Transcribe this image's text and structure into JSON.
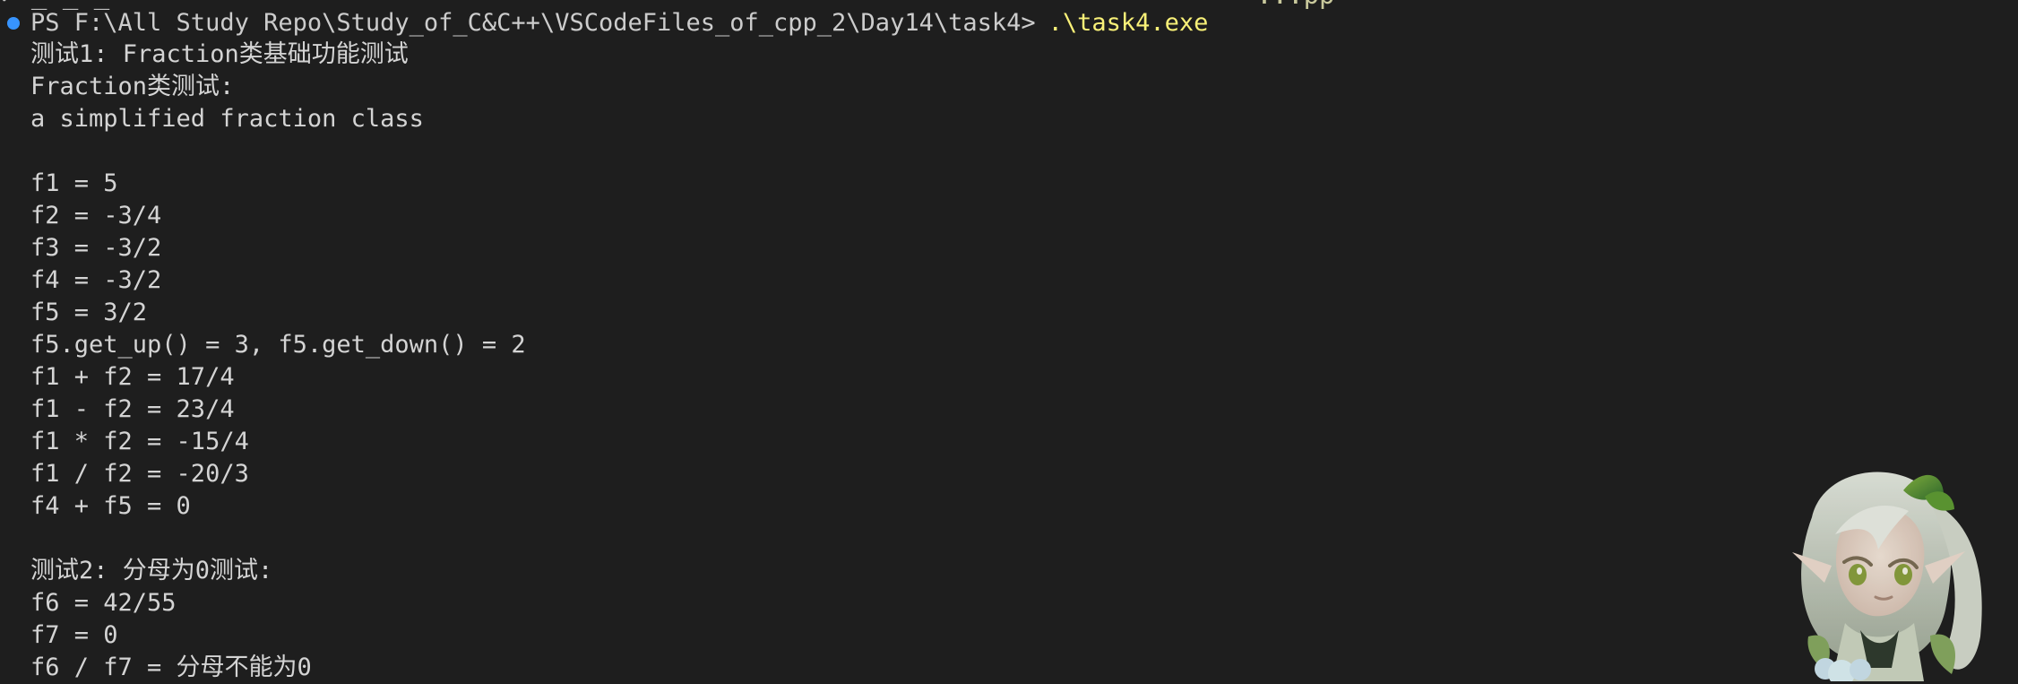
{
  "terminal": {
    "top_fragment_left": "✓ _ _ _",
    "top_fragment_right": "...pp",
    "prompt": {
      "path": "PS F:\\All Study Repo\\Study_of_C&C++\\VSCodeFiles_of_cpp_2\\Day14\\task4>",
      "command": ".\\task4.exe"
    },
    "lines": [
      "测试1: Fraction类基础功能测试",
      "Fraction类测试:",
      "a simplified fraction class",
      "",
      "f1 = 5",
      "f2 = -3/4",
      "f3 = -3/2",
      "f4 = -3/2",
      "f5 = 3/2",
      "f5.get_up() = 3, f5.get_down() = 2",
      "f1 + f2 = 17/4",
      "f1 - f2 = 23/4",
      "f1 * f2 = -15/4",
      "f1 / f2 = -20/3",
      "f4 + f5 = 0",
      "",
      "测试2: 分母为0测试:",
      "f6 = 42/55",
      "f7 = 0",
      "f6 / f7 = 分母不能为0"
    ],
    "colors": {
      "background": "#1e1e1e",
      "text": "#d4d4d4",
      "prompt_path": "#cccccc",
      "command": "#f9f178",
      "status_dot": "#3794ff"
    },
    "decoration": {
      "icon_name": "anime-character-decoration"
    }
  }
}
